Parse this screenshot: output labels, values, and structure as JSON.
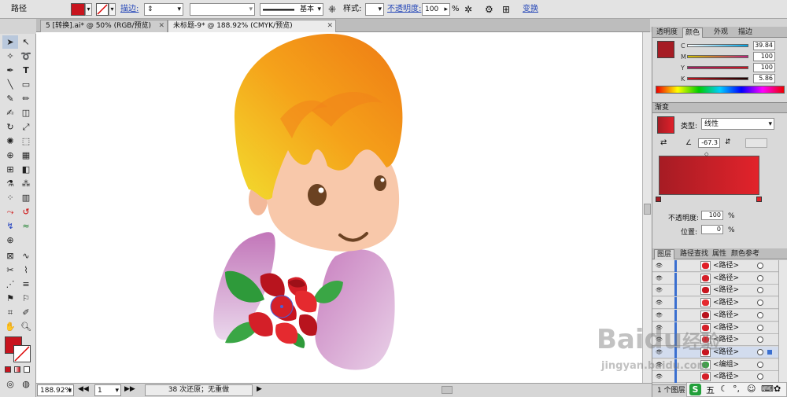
{
  "control_bar": {
    "object_type": "路径",
    "stroke_link": "描边:",
    "stroke_style": "基本",
    "style_label": "样式:",
    "opacity_link": "不透明度:",
    "opacity_value": "100",
    "opacity_unit": "%",
    "transform_link": "变换",
    "fill_color": "#c8141e"
  },
  "tabs": [
    {
      "label": "5 [转换].ai* @ 50% (RGB/预览)"
    },
    {
      "label": "未标题-9* @ 188.92% (CMYK/预览)"
    }
  ],
  "status_bar": {
    "zoom": "188.92%",
    "page": "1",
    "message": "38 次还原；无重做"
  },
  "color_panel": {
    "tabs": [
      "透明度",
      "颜色",
      "外观",
      "描边"
    ],
    "channels": [
      {
        "name": "C",
        "value": "39.84"
      },
      {
        "name": "M",
        "value": "100"
      },
      {
        "name": "Y",
        "value": "100"
      },
      {
        "name": "K",
        "value": "5.86"
      }
    ],
    "swatch_color": "#a61c24"
  },
  "gradient_panel": {
    "title": "渐变",
    "type_label": "类型:",
    "type_value": "线性",
    "angle_value": "-67.3",
    "opacity_label": "不透明度:",
    "opacity_value": "100",
    "opacity_unit": "%",
    "location_label": "位置:",
    "location_value": "0",
    "location_unit": "%"
  },
  "layers_panel": {
    "tabs": [
      "图层",
      "路径查找",
      "属性",
      "颜色参考"
    ],
    "rows": [
      "<路径>",
      "<路径>",
      "<路径>",
      "<路径>",
      "<路径>",
      "<路径>",
      "<路径>",
      "<路径>",
      "<编组>",
      "<路径>"
    ],
    "footer": "1 个图层"
  },
  "watermark": {
    "brand": "Baidu",
    "brand_suffix": "经验",
    "url": "jingyan.baidu.com"
  },
  "ime": {
    "label": "五"
  }
}
